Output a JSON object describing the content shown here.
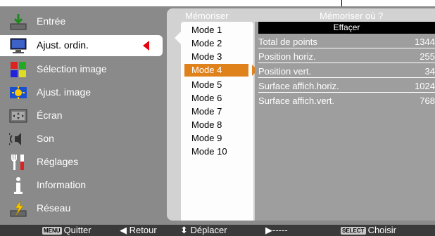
{
  "callout": {},
  "menu": {
    "items": [
      {
        "label": "Entrée",
        "icon": "input-icon",
        "selected": false
      },
      {
        "label": "Ajust. ordin.",
        "icon": "pc-adjust-icon",
        "selected": true
      },
      {
        "label": "Sélection image",
        "icon": "image-select-icon",
        "selected": false
      },
      {
        "label": "Ajust. image",
        "icon": "image-adjust-icon",
        "selected": false
      },
      {
        "label": "Écran",
        "icon": "screen-icon",
        "selected": false
      },
      {
        "label": "Son",
        "icon": "sound-icon",
        "selected": false
      },
      {
        "label": "Réglages",
        "icon": "settings-icon",
        "selected": false
      },
      {
        "label": "Information",
        "icon": "information-icon",
        "selected": false
      },
      {
        "label": "Réseau",
        "icon": "network-icon",
        "selected": false
      }
    ]
  },
  "panel": {
    "col1_header": "Mémoriser",
    "col2_header": "Mémoriser où ?",
    "modes": [
      "Mode 1",
      "Mode 2",
      "Mode 3",
      "Mode 4",
      "Mode 5",
      "Mode 6",
      "Mode 7",
      "Mode 8",
      "Mode 9",
      "Mode 10"
    ],
    "selected_mode": "Mode 4",
    "info_header": "Effaçer",
    "rows": [
      {
        "label": "Total de points",
        "value": "1344"
      },
      {
        "label": "Position horiz.",
        "value": "255"
      },
      {
        "label": "Position vert.",
        "value": "34"
      },
      {
        "label": "Surface affich.horiz.",
        "value": "1024"
      },
      {
        "label": "Surface affich.vert.",
        "value": "768"
      }
    ]
  },
  "footer": {
    "quit_key": "MENU",
    "quit_label": "Quitter",
    "back_label": "Retour",
    "move_label": "Déplacer",
    "next_label": "-----",
    "select_key": "SELECT",
    "select_label": "Choisir"
  },
  "colors": {
    "highlight": "#e0821c",
    "arrow_red": "#e8000d",
    "background": "#8a8a8a"
  }
}
